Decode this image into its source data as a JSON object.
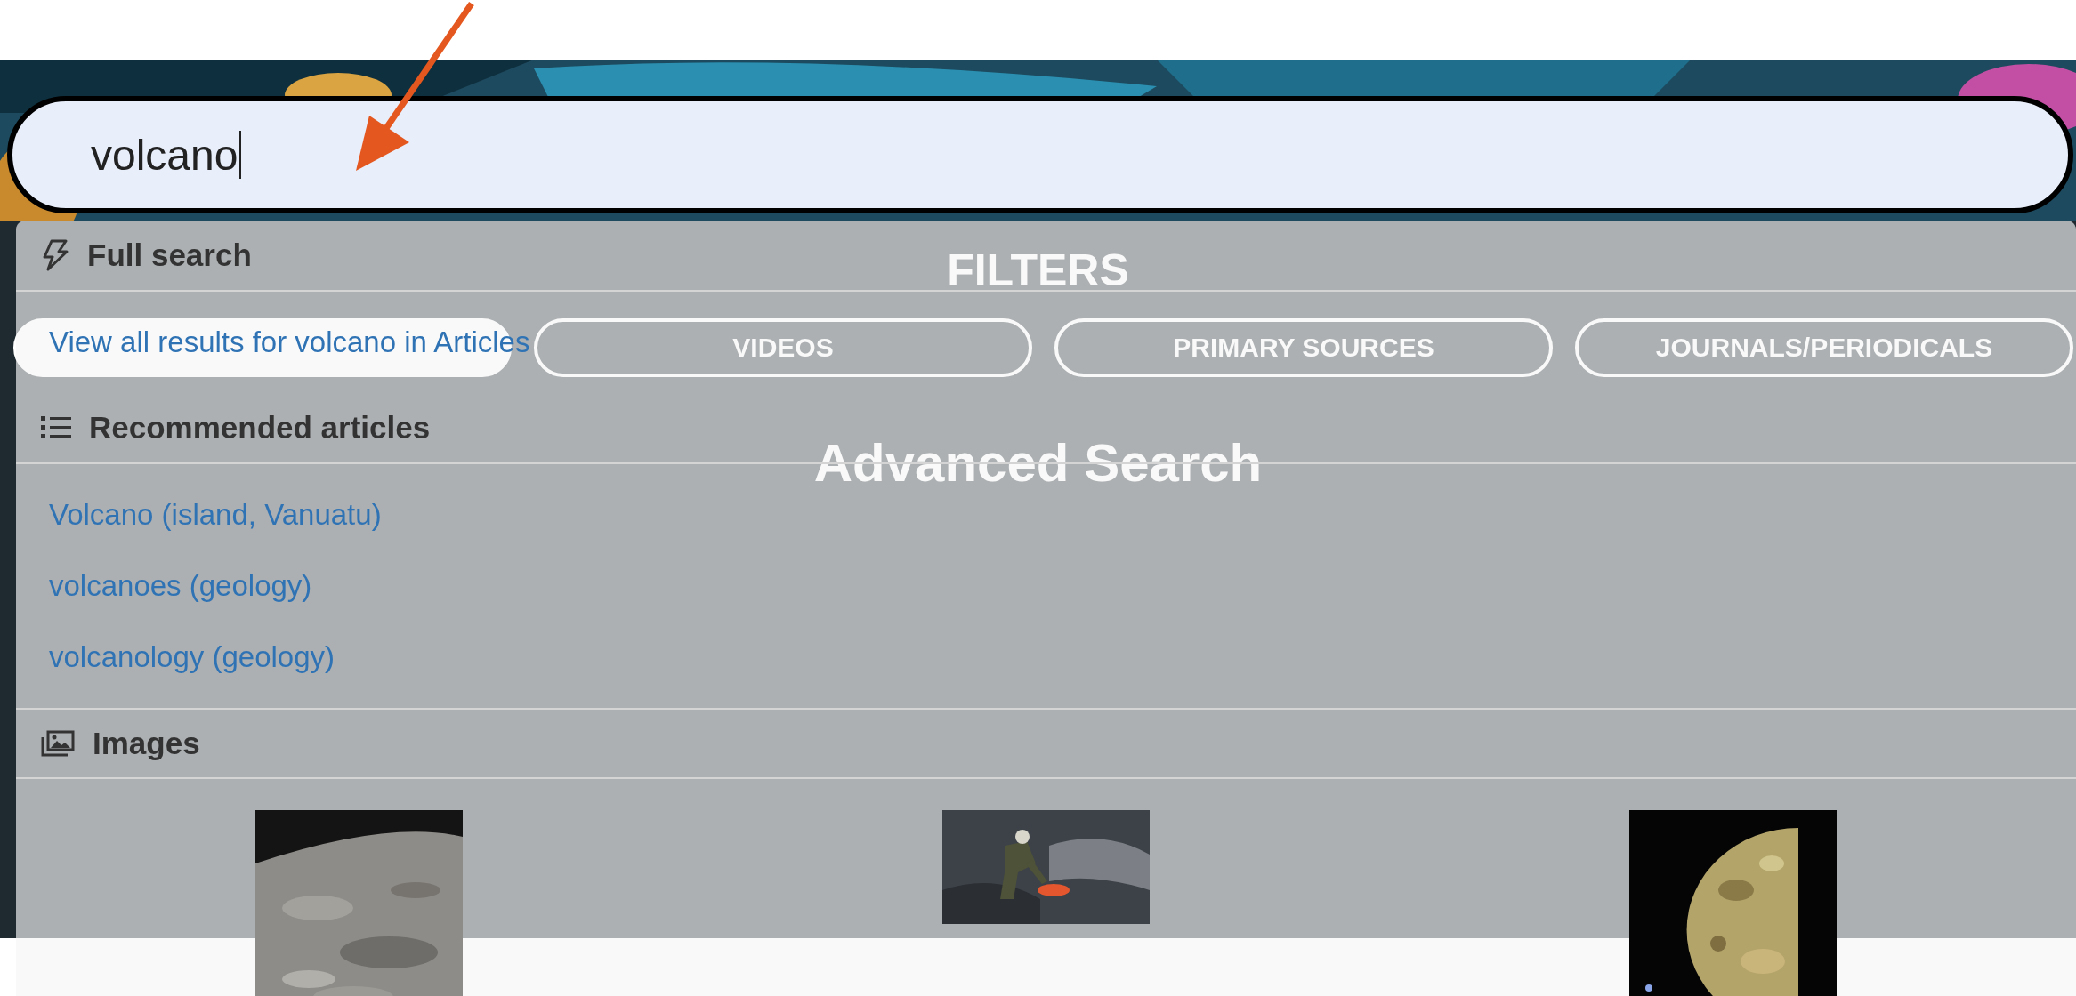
{
  "search": {
    "value": "volcano"
  },
  "page": {
    "filters_title": "FILTERS",
    "filters": [
      {
        "selected": true
      },
      {
        "label": "VIDEOS",
        "selected": false
      },
      {
        "label": "PRIMARY SOURCES",
        "selected": false
      },
      {
        "label": "JOURNALS/PERIODICALS",
        "selected": false
      }
    ],
    "heading": "Advanced Search"
  },
  "dropdown": {
    "sections": [
      {
        "kind": "full",
        "title": "Full search",
        "links": [
          "View all results for volcano in Articles"
        ]
      },
      {
        "kind": "list",
        "title": "Recommended articles",
        "links": [
          "Volcano (island, Vanuatu)",
          "volcanoes (geology)",
          "volcanology (geology)"
        ]
      },
      {
        "kind": "images",
        "title": "Images"
      }
    ]
  }
}
